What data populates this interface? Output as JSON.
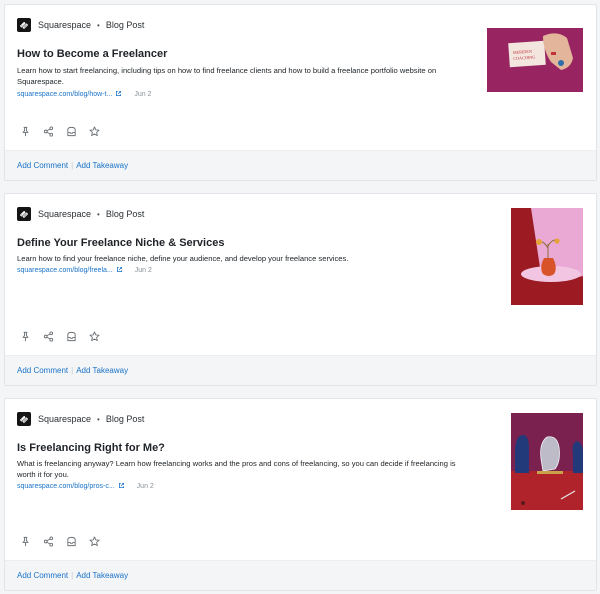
{
  "posts": [
    {
      "source": "Squarespace",
      "type": "Blog Post",
      "title": "How to Become a Freelancer",
      "description": "Learn how to start freelancing, including tips on how to find freelance clients and how to build a freelance portfolio website on Squarespace.",
      "link_text": "squarespace.com/blog/how-t...",
      "date": "Jun 2",
      "thumb_text_line1": "MERIDEN",
      "thumb_text_line2": "COACHING"
    },
    {
      "source": "Squarespace",
      "type": "Blog Post",
      "title": "Define Your Freelance Niche & Services",
      "description": "Learn how to find your freelance niche, define your audience, and develop your freelance services.",
      "link_text": "squarespace.com/blog/freela...",
      "date": "Jun 2"
    },
    {
      "source": "Squarespace",
      "type": "Blog Post",
      "title": "Is Freelancing Right for Me?",
      "description": "What is freelancing anyway? Learn how freelancing works and the pros and cons of freelancing, so you can decide if freelancing is worth it for you.",
      "link_text": "squarespace.com/blog/pros-c...",
      "date": "Jun 2"
    }
  ],
  "footer": {
    "add_comment": "Add Comment",
    "add_takeaway": "Add Takeaway"
  },
  "icons": [
    "squarespace-logo-icon",
    "pin-icon",
    "share-icon",
    "archive-icon",
    "star-icon",
    "external-link-icon"
  ],
  "colors": {
    "link": "#1a73c9",
    "card_bg": "#ffffff",
    "footer_bg": "#f4f5f6",
    "thumb1_bg": "#a8296a",
    "thumb2_bg": "#9c1a22",
    "thumb3_bg": "#8a2140"
  }
}
